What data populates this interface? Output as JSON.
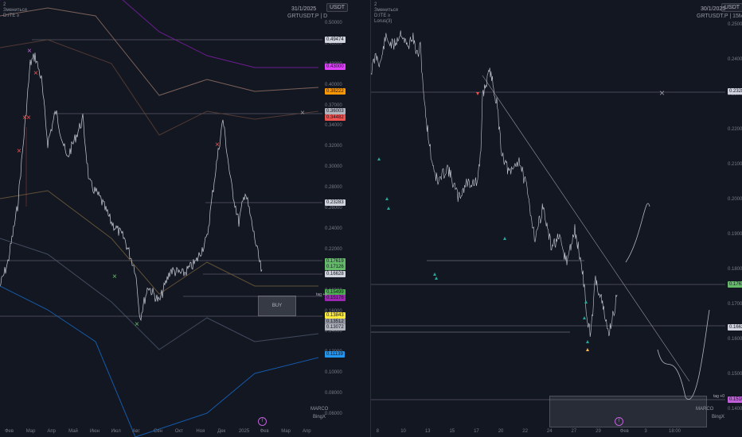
{
  "left": {
    "date": "31/1/2025",
    "symbol": "GRTUSDT.P | D",
    "ccy": "USDT",
    "indicators": [
      "2",
      "Змениться",
      "D:ITE ≥"
    ],
    "axis_labels": [
      "0.50000",
      "0.46000",
      "0.43000",
      "0.40000",
      "0.37000",
      "0.34000",
      "0.32000",
      "0.30000",
      "0.28000",
      "0.26000",
      "0.24000",
      "0.22000",
      "0.20000",
      "0.18000",
      "0.16000",
      "0.14000",
      "0.12000",
      "0.10000",
      "0.08000",
      "0.06000"
    ],
    "tags": [
      {
        "text": "0.49474",
        "bg": "#d1d4dc"
      },
      {
        "text": "0.43000",
        "bg": "#e040fb"
      },
      {
        "text": "0.38222",
        "bg": "#ff9800"
      },
      {
        "text": "0.36003",
        "bg": "#b2b5be"
      },
      {
        "text": "0.34482",
        "bg": "#ef5350"
      },
      {
        "text": "0.23283",
        "bg": "#d1d4dc"
      },
      {
        "text": "0.17619",
        "bg": "#66bb6a"
      },
      {
        "text": "0.17126",
        "bg": "#66bb6a"
      },
      {
        "text": "0.16628",
        "bg": "#d1d4dc"
      },
      {
        "text": "0.15499",
        "bg": "#4caf50"
      },
      {
        "text": "0.15176",
        "bg": "#9c27b0"
      },
      {
        "text": "0.13843",
        "bg": "#ffeb3b"
      },
      {
        "text": "0.13512",
        "bg": "#9598a1"
      },
      {
        "text": "0.13072",
        "bg": "#b2b5be"
      },
      {
        "text": "0.11139",
        "bg": "#2196f3"
      }
    ],
    "x_labels": [
      "Фев",
      "Мар",
      "Апр",
      "Май",
      "Июн",
      "Июл",
      "Авг",
      "Сен",
      "Окт",
      "Ноя",
      "Дек",
      "2025",
      "Фев",
      "Мар",
      "Апр"
    ],
    "buy_text": "BUY",
    "tag_text": "tag +0",
    "brand1": "MARCO",
    "brand2": "BingX",
    "logo": "f"
  },
  "right": {
    "date": "30/1/2025",
    "symbol": "GRTUSDT.P | 15M",
    "ccy": "USDT",
    "indicators": [
      "2",
      "Змениться",
      "D:ITE ≥",
      "Lorus(3)"
    ],
    "axis_labels": [
      "0.25000",
      "0.24000",
      "0.23000",
      "0.22000",
      "0.21000",
      "0.20000",
      "0.19000",
      "0.18000",
      "0.17000",
      "0.16000",
      "0.15000",
      "0.14000"
    ],
    "tags": [
      {
        "text": "0.23283",
        "bg": "#d1d4dc"
      },
      {
        "text": "0.17619",
        "bg": "#66bb6a"
      },
      {
        "text": "0.16628",
        "bg": "#d1d4dc"
      },
      {
        "text": "0.15108",
        "bg": "#c15fd8"
      }
    ],
    "x_labels": [
      "6",
      "8",
      "10",
      "13",
      "15",
      "17",
      "20",
      "22",
      "24",
      "27",
      "29",
      "Фев",
      "3",
      "18:00"
    ],
    "tag_text": "tag +0",
    "brand1": "MARCO",
    "brand2": "BingX",
    "logo": "f"
  },
  "chart_data": [
    {
      "type": "line",
      "title": "GRTUSDT.P | D",
      "x": [
        "Фев",
        "Мар",
        "Апр",
        "Май",
        "Июн",
        "Июл",
        "Авг",
        "Сен",
        "Окт",
        "Ноя",
        "Дек",
        "2025",
        "Фев"
      ],
      "series": [
        {
          "values": [
            0.16,
            0.43,
            0.32,
            0.26,
            0.18,
            0.16,
            0.12,
            0.14,
            0.15,
            0.32,
            0.22,
            0.17,
            0.166
          ]
        }
      ],
      "ylim": [
        0.05,
        0.52
      ]
    },
    {
      "type": "line",
      "title": "GRTUSDT.P | 15M",
      "x": [
        "6",
        "8",
        "10",
        "13",
        "15",
        "17",
        "20",
        "22",
        "24",
        "27",
        "29",
        "Фев"
      ],
      "series": [
        {
          "values": [
            0.245,
            0.25,
            0.21,
            0.2,
            0.18,
            0.235,
            0.21,
            0.195,
            0.18,
            0.165,
            0.16,
            0.176
          ]
        }
      ],
      "ylim": [
        0.14,
        0.26
      ]
    }
  ]
}
